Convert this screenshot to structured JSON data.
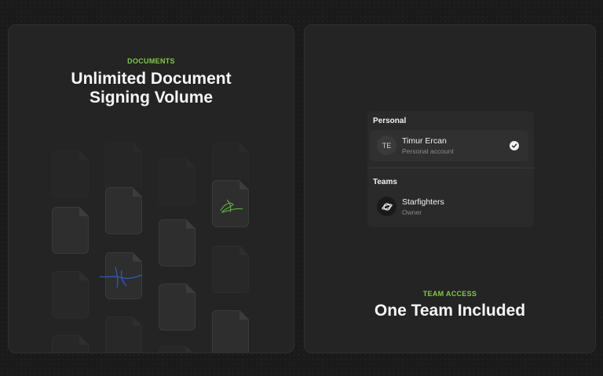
{
  "documents_card": {
    "eyebrow": "DOCUMENTS",
    "heading": "Unlimited Document Signing Volume"
  },
  "team_card": {
    "eyebrow": "TEAM ACCESS",
    "heading": "One Team Included"
  },
  "switcher": {
    "personal_label": "Personal",
    "personal_account": {
      "initials": "TE",
      "name": "Timur Ercan",
      "subtitle": "Personal account",
      "selected": true
    },
    "teams_label": "Teams",
    "team": {
      "name": "Starfighters",
      "role": "Owner",
      "icon": "planet-icon"
    }
  },
  "colors": {
    "accent_green": "#7fcb3f",
    "signature_blue": "#2f5fd6",
    "signature_green": "#5fbf3a",
    "background": "#1a1a1a",
    "card": "#242424"
  }
}
